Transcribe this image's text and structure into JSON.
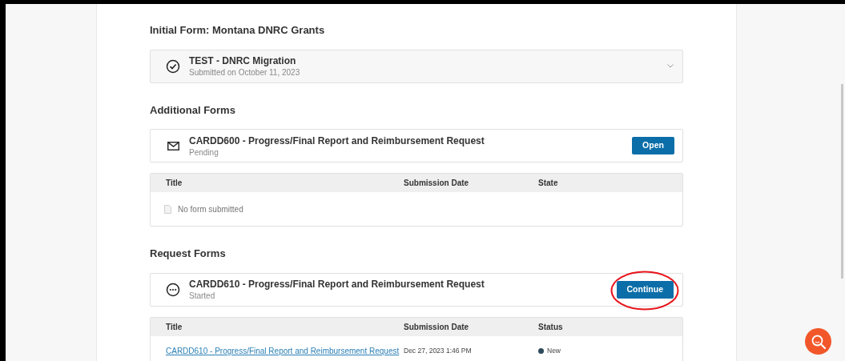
{
  "sections": [
    {
      "heading": "Initial Form: Montana DNRC Grants",
      "card": {
        "kind": "check",
        "title": "TEST - DNRC Migration",
        "subtitle": "Submitted on October 11, 2023",
        "expanded": false
      }
    },
    {
      "heading": "Additional Forms",
      "card": {
        "kind": "mail",
        "title": "CARDD600 - Progress/Final Report and Reimbursement Request",
        "subtitle": "Pending",
        "button": "Open"
      },
      "table": {
        "columns": [
          "Title",
          "Submission Date",
          "State"
        ],
        "empty_message": "No form submitted"
      }
    },
    {
      "heading": "Request Forms",
      "card": {
        "kind": "dots",
        "title": "CARDD610 - Progress/Final Report and Reimbursement Request",
        "subtitle": "Started",
        "button": "Continue",
        "circled": true
      },
      "table": {
        "columns": [
          "Title",
          "Submission Date",
          "Status"
        ],
        "rows": [
          {
            "title": "CARDD610 - Progress/Final Report and Reimbursement Request",
            "date": "Dec 27, 2023 1:46 PM",
            "status": "New",
            "color": "#2c4a5a"
          }
        ]
      }
    }
  ]
}
